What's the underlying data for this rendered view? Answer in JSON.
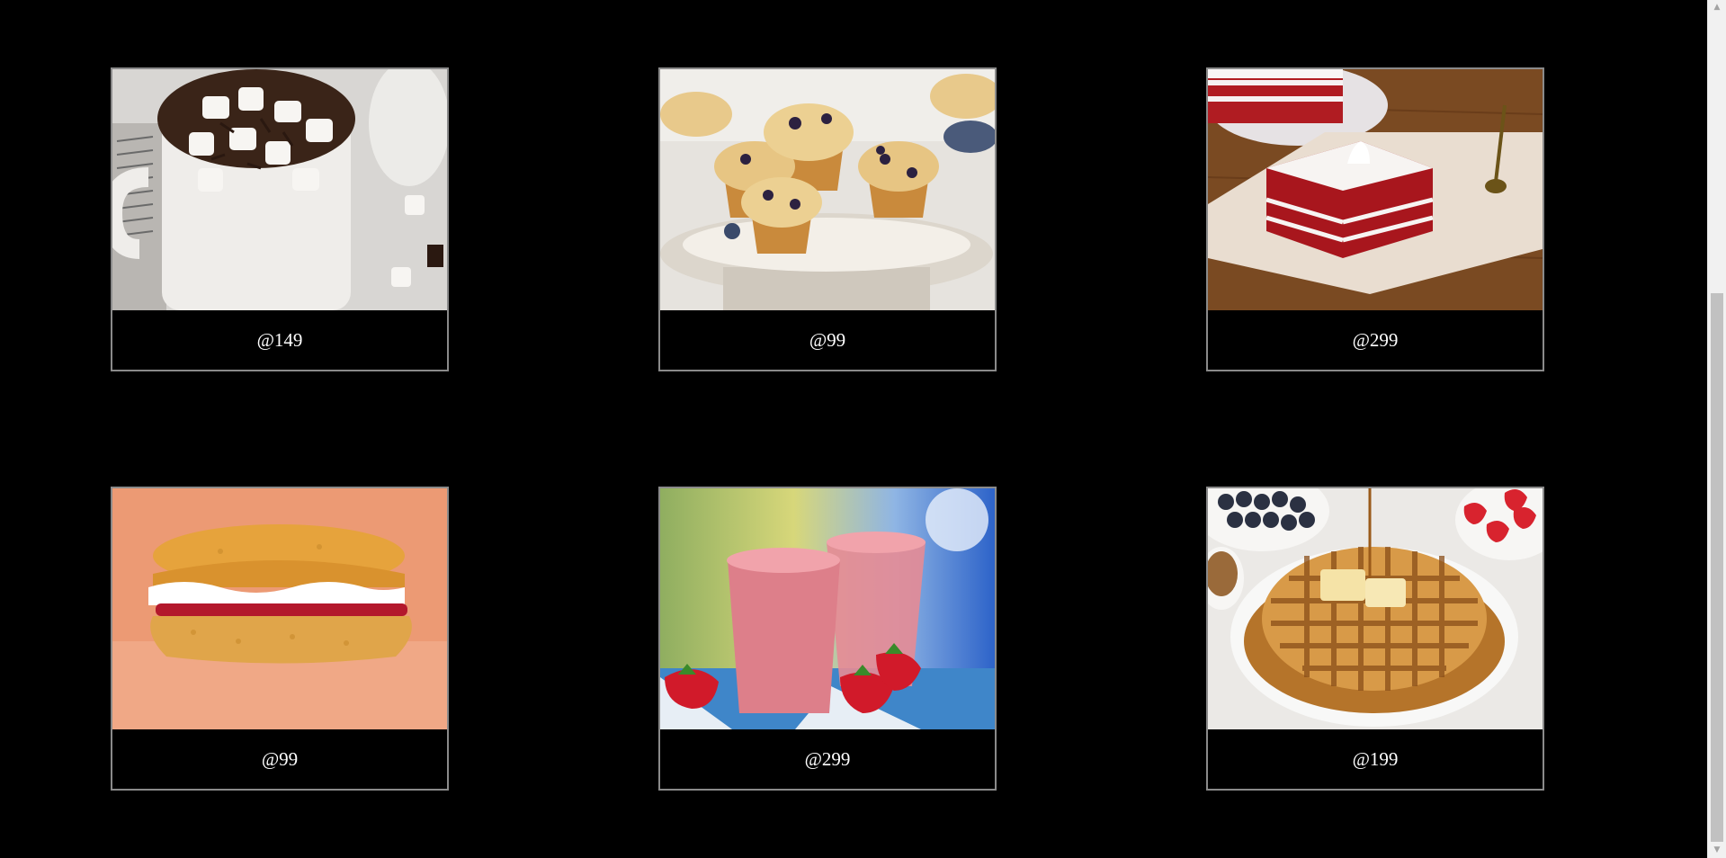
{
  "products": [
    {
      "price": "@149",
      "image": "hot-chocolate-with-marshmallows"
    },
    {
      "price": "@99",
      "image": "blueberry-muffins"
    },
    {
      "price": "@299",
      "image": "red-velvet-cake"
    },
    {
      "price": "@99",
      "image": "scone-with-cream-and-jam"
    },
    {
      "price": "@299",
      "image": "strawberry-smoothie"
    },
    {
      "price": "@199",
      "image": "waffles-with-syrup"
    }
  ],
  "colors": {
    "background": "#000000",
    "card_border": "#8a8a8a",
    "price_text": "#ffffff"
  }
}
